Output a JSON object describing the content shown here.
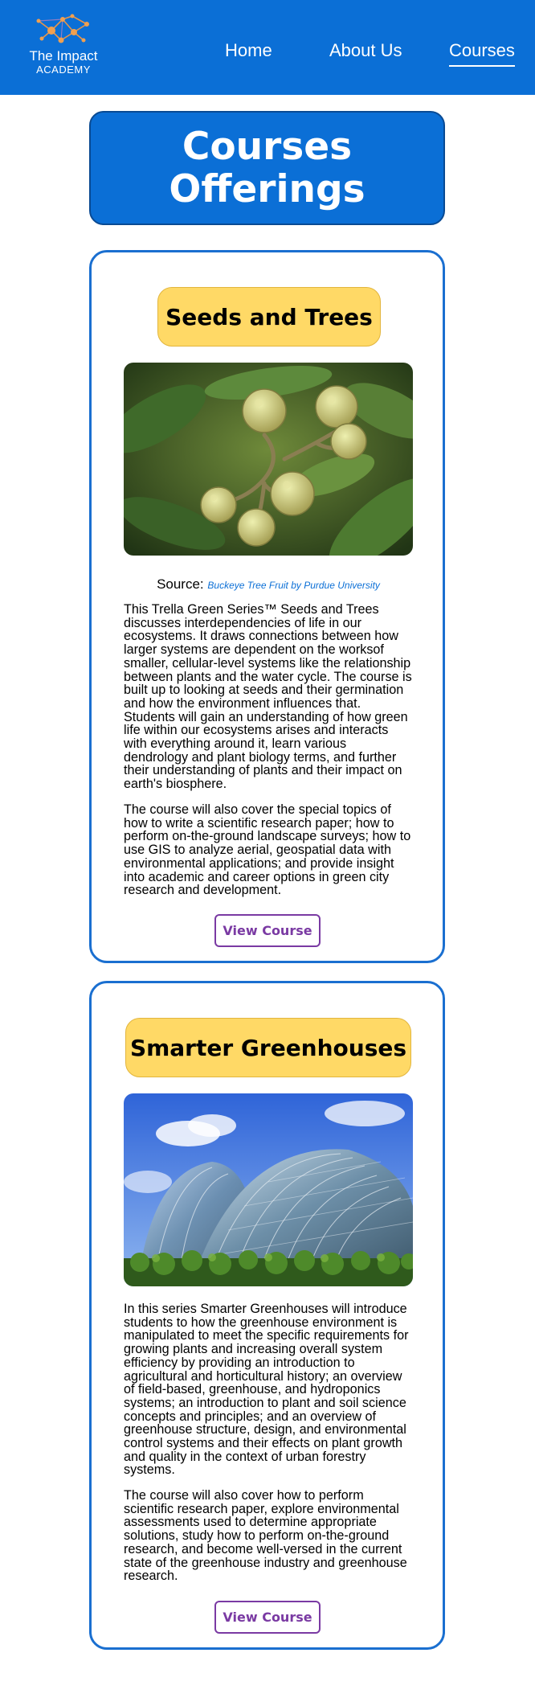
{
  "logo": {
    "title": "The Impact",
    "subtitle": "ACADEMY",
    "icon": "molecule-network-icon"
  },
  "nav": {
    "home": "Home",
    "about": "About Us",
    "courses": "Courses"
  },
  "banner": {
    "title": "Courses Offerings"
  },
  "courses": [
    {
      "title": "Seeds and Trees",
      "image": "buckeye-fruit-image",
      "source_prefix": "Source:",
      "source_link": "Buckeye Tree Fruit by Purdue University",
      "paragraphs": [
        "This Trella Green Series™ Seeds and Trees discusses interdependencies of life in our ecosystems. It draws connections between how larger systems are dependent on the worksof smaller, cellular-level systems like the relationship between plants and the water cycle. The course is built up to looking at seeds and their germination and how the environment influences that. Students will gain an understanding of how green life within our ecosystems arises and interacts with everything around it, learn various dendrology and plant biology terms, and further their understanding of plants and their impact on earth's biosphere.",
        "The course will also cover the special topics of how to write a scientific research paper; how to perform on-the-ground landscape surveys; how to use GIS to analyze aerial, geospatial data with environmental applications; and provide insight into academic and career options in green city research and development."
      ],
      "button": "View Course"
    },
    {
      "title": "Smarter Greenhouses",
      "image": "glass-greenhouse-image",
      "paragraphs": [
        "In this series Smarter Greenhouses will introduce students to how the greenhouse environment is manipulated to meet the specific requirements for growing plants and increasing overall system efficiency by providing an introduction to agricultural and horticultural history; an overview of field-based, greenhouse, and hydroponics systems; an introduction to plant and soil science concepts and principles; and an overview of greenhouse structure, design, and environmental control systems and their effects on plant growth and quality in the context of urban forestry systems.",
        "The course will also cover how to perform scientific research paper, explore environmental assessments used to determine appropriate solutions, study how to perform on-the-ground research, and become well-versed in the current state of the greenhouse industry and greenhouse research."
      ],
      "button": "View Course"
    }
  ],
  "colors": {
    "primary": "#0b6fd6",
    "title_bg": "#ffd966",
    "button": "#7a3aa3"
  }
}
